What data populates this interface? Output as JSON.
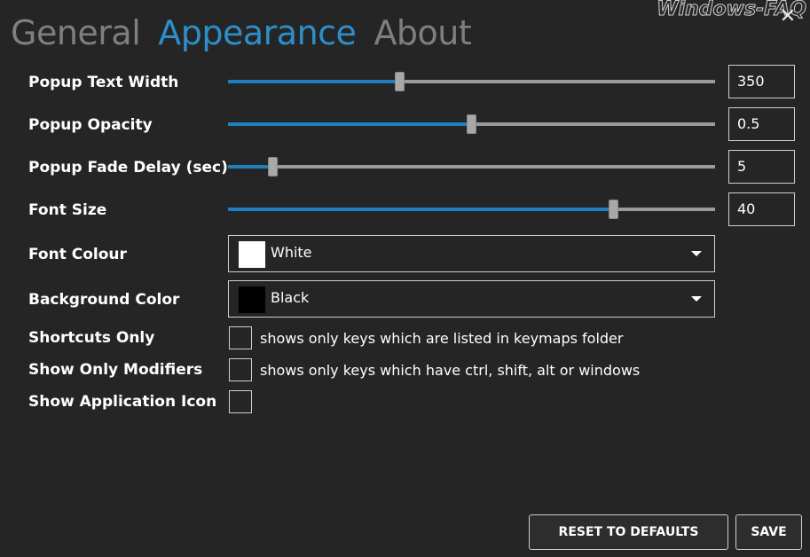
{
  "watermark": "Windows-FAQ",
  "close_glyph": "✕",
  "tabs": [
    {
      "label": "General",
      "active": false
    },
    {
      "label": "Appearance",
      "active": true
    },
    {
      "label": "About",
      "active": false
    }
  ],
  "sliders": [
    {
      "label": "Popup Text Width",
      "value": "350",
      "fraction": 0.353
    },
    {
      "label": "Popup Opacity",
      "value": "0.5",
      "fraction": 0.5
    },
    {
      "label": "Popup Fade Delay (sec)",
      "value": "5",
      "fraction": 0.093
    },
    {
      "label": "Font Size",
      "value": "40",
      "fraction": 0.793
    }
  ],
  "font_colour": {
    "label": "Font Colour",
    "value": "White",
    "swatch": "#ffffff"
  },
  "background_color": {
    "label": "Background Color",
    "value": "Black",
    "swatch": "#000000"
  },
  "checkboxes": [
    {
      "label": "Shortcuts Only",
      "description": "shows only keys which are listed in keymaps folder",
      "checked": false
    },
    {
      "label": "Show Only Modifiers",
      "description": "shows only keys which have ctrl, shift, alt or windows",
      "checked": false
    },
    {
      "label": "Show Application Icon",
      "description": "",
      "checked": false
    }
  ],
  "buttons": {
    "reset": "RESET TO DEFAULTS",
    "save": "SAVE"
  },
  "colors": {
    "accent": "#2d8fc9",
    "slider_fill": "#1e7fbf",
    "background": "#252526"
  },
  "icons": {
    "close": "close-icon",
    "dropdown": "chevron-down-icon"
  }
}
